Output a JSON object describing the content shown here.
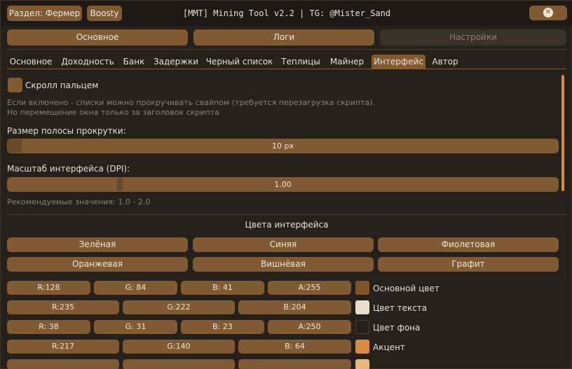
{
  "titlebar": {
    "section_label": "Раздел: Фермер",
    "boosty_label": "Boosty",
    "title": "[MMT] Mining Tool v2.2 | TG: @Mister_Sand",
    "close_symbol": "✕"
  },
  "sections": [
    "Основное",
    "Логи",
    "Настройки"
  ],
  "tabs": [
    "Основное",
    "Доходность",
    "Банк",
    "Задержки",
    "Черный список",
    "Теплицы",
    "Майнер",
    "Интерфейс",
    "Автор"
  ],
  "active_tab": "Интерфейс",
  "settings": {
    "scroll_finger_label": "Скролл пальцем",
    "scroll_hint_1": "Если включено - списки можно прокручивать свайпом (требуется перезагрузка скрипта).",
    "scroll_hint_2": "Но перемещение окна только за заголовок скрипта",
    "scrollbar_size_label": "Размер полосы прокрутки:",
    "scrollbar_size_value": "10 px",
    "scale_label": "Масштаб интерфейса (DPI):",
    "scale_value": "1.00",
    "scale_hint": "Рекомендуемые значения: 1.0 - 2.0"
  },
  "colors_section": {
    "title": "Цвета интерфейса",
    "themes": [
      "Зелёная",
      "Синяя",
      "Фиолетовая",
      "Оранжевая",
      "Вишнёвая",
      "Графит"
    ],
    "rows": [
      {
        "channels": [
          "R:128",
          "G: 84",
          "B: 41",
          "A:255"
        ],
        "label": "Основной цвет",
        "swatch": "#805429"
      },
      {
        "channels": [
          "R:235",
          "G:222",
          "B:204"
        ],
        "label": "Цвет текста",
        "swatch": "#ebdecc"
      },
      {
        "channels": [
          "R: 38",
          "G: 31",
          "B: 23",
          "A:250"
        ],
        "label": "Цвет фона",
        "swatch": "#261f17"
      },
      {
        "channels": [
          "R:217",
          "G:140",
          "B: 64"
        ],
        "label": "Акцент",
        "swatch": "#d98c40"
      }
    ]
  },
  "accent_color": "#805a32",
  "background_color": "#26201a"
}
